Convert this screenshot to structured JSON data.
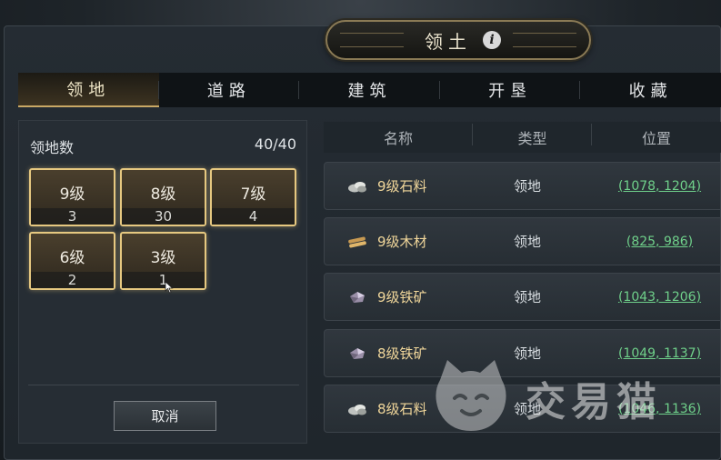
{
  "title": "领土",
  "tabs": [
    "领地",
    "道路",
    "建筑",
    "开垦",
    "收藏"
  ],
  "left": {
    "territory_label": "领地数",
    "territory_count": "40/40",
    "levels": [
      {
        "level": "9级",
        "count": "3"
      },
      {
        "level": "8级",
        "count": "30"
      },
      {
        "level": "7级",
        "count": "4"
      },
      {
        "level": "6级",
        "count": "2"
      },
      {
        "level": "3级",
        "count": "1"
      }
    ],
    "cancel_label": "取消"
  },
  "table": {
    "headers": [
      "名称",
      "类型",
      "位置"
    ],
    "rows": [
      {
        "icon": "stone-icon",
        "name": "9级石料",
        "type": "领地",
        "position": "(1078, 1204)"
      },
      {
        "icon": "wood-icon",
        "name": "9级木材",
        "type": "领地",
        "position": "(825, 986)"
      },
      {
        "icon": "iron-ore-icon",
        "name": "9级铁矿",
        "type": "领地",
        "position": "(1043, 1206)"
      },
      {
        "icon": "iron-ore-icon",
        "name": "8级铁矿",
        "type": "领地",
        "position": "(1049, 1137)"
      },
      {
        "icon": "stone-icon",
        "name": "8级石料",
        "type": "领地",
        "position": "(1046, 1136)"
      }
    ]
  },
  "watermark": "交易猫",
  "colors": {
    "accent_gold": "#e6c880",
    "resource_name": "#f0d69a",
    "link_green": "#6fd08a",
    "panel_bg": "#262d34"
  }
}
